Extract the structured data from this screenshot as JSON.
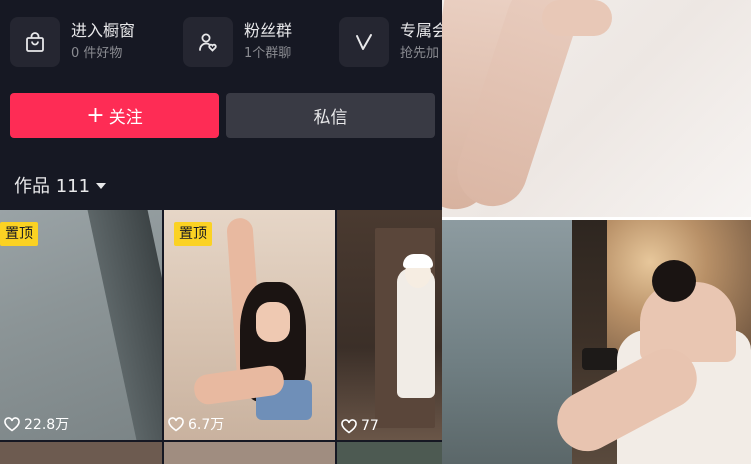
{
  "shortcuts": [
    {
      "title": "进入橱窗",
      "subtitle": "0 件好物",
      "icon": "shopping-bag-icon"
    },
    {
      "title": "粉丝群",
      "subtitle": "1个群聊",
      "icon": "fan-group-icon"
    },
    {
      "title": "专属会",
      "subtitle": "抢先加",
      "icon": "v-badge-icon"
    }
  ],
  "buttons": {
    "follow_plus": "+",
    "follow_label": "关注",
    "message_label": "私信"
  },
  "works": {
    "label": "作品 111"
  },
  "tiles": [
    {
      "pinned": "置顶",
      "likes": "22.8万"
    },
    {
      "pinned": "置顶",
      "likes": "6.7万"
    },
    {
      "likes": "77"
    }
  ],
  "colors": {
    "background": "#161823",
    "follow_button": "#fe2c55",
    "message_button": "#393a44",
    "pin_badge": "#fbd223"
  }
}
